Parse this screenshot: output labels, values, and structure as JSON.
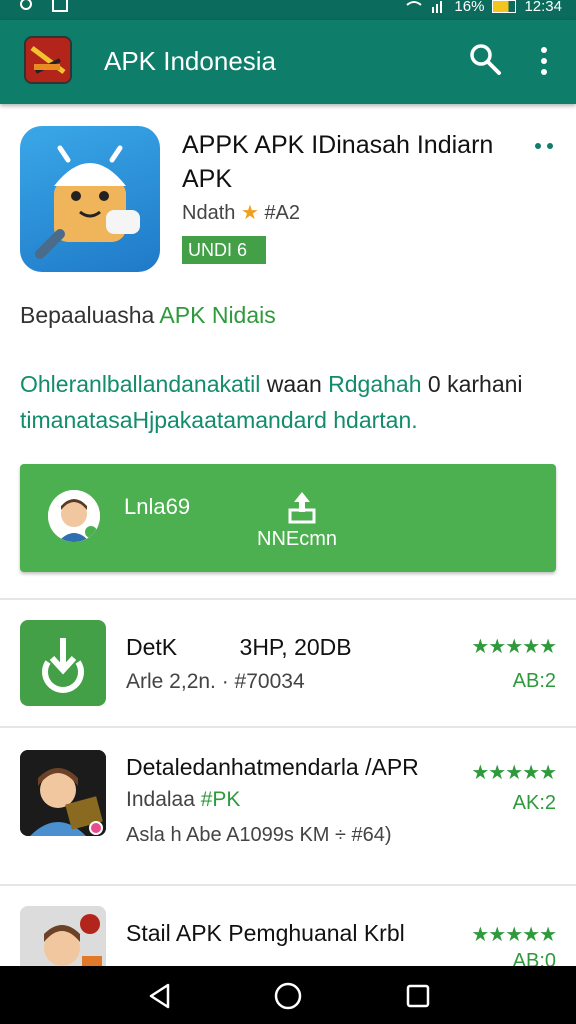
{
  "status_bar": {
    "battery_text": "16%",
    "time": "12:34"
  },
  "app_bar": {
    "title": "APK Indonesia"
  },
  "hero": {
    "title": "APPK APK IDinasah Indiarn APK",
    "subtitle_prefix": "Ndath",
    "subtitle_rating": "#A2",
    "badge": "UNDI 6"
  },
  "description": {
    "line1_prefix": "Bepaaluasha",
    "line1_link": "APK Nidais",
    "para_green1": "Ohleranlballandanakatil",
    "para_dark1": "waan",
    "para_green2": "Rdgahah",
    "para_dark2": "0 karhani",
    "para_green3": "timanatasaHjpakaa",
    "para_green4": "tamandard hdartan."
  },
  "install": {
    "left_label": "Lnla69",
    "right_label": "NNEcmn"
  },
  "apps": [
    {
      "icon": "download-icon",
      "title": "DetK",
      "title_extra": "3HP, 20DB",
      "subtitle": "Arle 2,2n. · #70034",
      "stars": "★★★★★",
      "rating": "AB:2"
    },
    {
      "icon": "person-book-icon",
      "title": "Detaledanhatmendarla /APR",
      "subtitle_prefix": "Indalaa",
      "subtitle_link": "#PK",
      "meta": "Asla h Abe A1099s KM ÷ #64)",
      "stars": "★★★★★",
      "rating": "AK:2"
    },
    {
      "icon": "person-avatar-icon",
      "title": "Stail APK Pemghuanal Krbl",
      "stars": "★★★★★",
      "rating": "AB:0"
    }
  ],
  "colors": {
    "app_bar": "#0e7d6a",
    "accent_green": "#4caf50",
    "text_green": "#2e9a3c"
  }
}
